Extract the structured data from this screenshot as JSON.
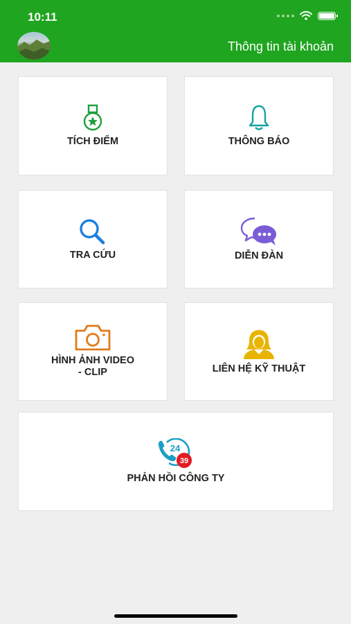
{
  "status_bar": {
    "time": "10:11"
  },
  "header": {
    "account_label": "Thông tin tài khoản"
  },
  "tiles": [
    {
      "label": "TÍCH ĐIỂM",
      "icon": "medal-icon",
      "color": "#1e9e3c"
    },
    {
      "label": "THÔNG BÁO",
      "icon": "bell-icon",
      "color": "#13a3a0"
    },
    {
      "label": "TRA CỨU",
      "icon": "search-icon",
      "color": "#1b7fe0"
    },
    {
      "label": "DIỄN ĐÀN",
      "icon": "chat-bubbles-icon",
      "color": "#7b5cd6"
    },
    {
      "label": "HÌNH ẢNH VIDEO\n- CLIP",
      "icon": "camera-icon",
      "color": "#e07b1a"
    },
    {
      "label": "LIÊN HỆ KỸ THUẬT",
      "icon": "support-agent-icon",
      "color": "#e8b400"
    },
    {
      "label": "PHẢN HỒI CÔNG TY",
      "icon": "phone-24-icon",
      "color": "#1b9fc4",
      "badge": "39",
      "icon_text": "24"
    }
  ]
}
